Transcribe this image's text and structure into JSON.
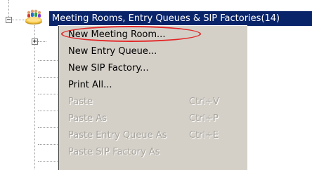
{
  "tree": {
    "root_label": "Meeting Rooms, Entry Queues & SIP Factories(14)",
    "root_expander": "−",
    "child_expander": "+",
    "root_icon": "conference-people-icon"
  },
  "context_menu": {
    "items": [
      {
        "label": "New Meeting Room...",
        "shortcut": "",
        "enabled": true
      },
      {
        "label": "New Entry Queue...",
        "shortcut": "",
        "enabled": true
      },
      {
        "label": "New SIP Factory...",
        "shortcut": "",
        "enabled": true
      },
      {
        "label": "Print All...",
        "shortcut": "",
        "enabled": true
      },
      {
        "label": "Paste",
        "shortcut": "Ctrl+V",
        "enabled": false
      },
      {
        "label": "Paste As",
        "shortcut": "Ctrl+P",
        "enabled": false
      },
      {
        "label": "Paste Entry Queue As",
        "shortcut": "Ctrl+E",
        "enabled": false
      },
      {
        "label": "Paste SIP Factory As",
        "shortcut": "",
        "enabled": false
      }
    ]
  },
  "colors": {
    "selection": "#0a246a",
    "menu_background": "#d4d0c8",
    "highlight_ellipse": "#e32626",
    "disabled_text": "#a8a59e"
  }
}
